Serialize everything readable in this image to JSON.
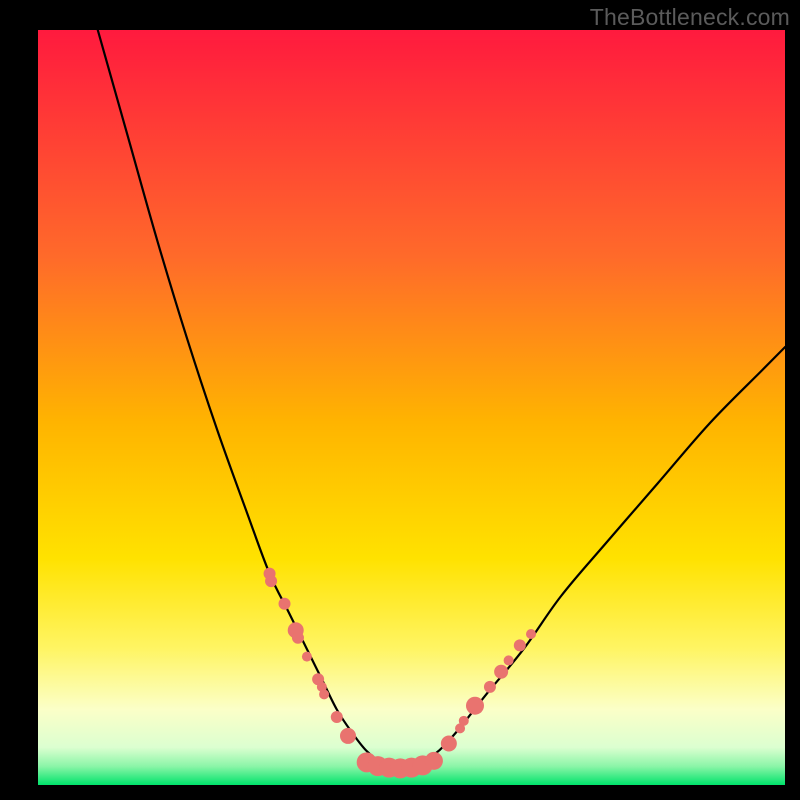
{
  "watermark": "TheBottleneck.com",
  "chart_data": {
    "type": "line",
    "title": "",
    "xlabel": "",
    "ylabel": "",
    "xlim": [
      0,
      100
    ],
    "ylim": [
      0,
      100
    ],
    "grid": false,
    "legend": false,
    "gradient_colors": [
      "#ff1a3e",
      "#ffb400",
      "#ffea00",
      "#fff97a",
      "#f8ffd8",
      "#00e36b"
    ],
    "curve": {
      "name": "bottleneck-curve",
      "x": [
        8,
        12,
        16,
        20,
        24,
        28,
        31,
        33.5,
        36,
        38,
        40,
        42,
        44,
        46,
        48,
        50,
        53,
        56,
        60,
        65,
        70,
        76,
        83,
        90,
        97,
        100
      ],
      "y": [
        100,
        86,
        72,
        59,
        47,
        36,
        28,
        23,
        18,
        14,
        10,
        7,
        4.5,
        3,
        2.3,
        2.5,
        4,
        7,
        12,
        18,
        25,
        32,
        40,
        48,
        55,
        58
      ]
    },
    "markers": {
      "name": "highlight-points",
      "color": "#e9736f",
      "radius_range": [
        4.5,
        11
      ],
      "points": [
        {
          "x": 31.0,
          "y": 28.0,
          "r": 6
        },
        {
          "x": 31.2,
          "y": 27.0,
          "r": 6
        },
        {
          "x": 33.0,
          "y": 24.0,
          "r": 6
        },
        {
          "x": 34.5,
          "y": 20.5,
          "r": 8
        },
        {
          "x": 34.8,
          "y": 19.5,
          "r": 6
        },
        {
          "x": 36.0,
          "y": 17.0,
          "r": 5
        },
        {
          "x": 37.5,
          "y": 14.0,
          "r": 6
        },
        {
          "x": 38.0,
          "y": 13.0,
          "r": 5
        },
        {
          "x": 38.3,
          "y": 12.0,
          "r": 5
        },
        {
          "x": 40.0,
          "y": 9.0,
          "r": 6
        },
        {
          "x": 41.5,
          "y": 6.5,
          "r": 8
        },
        {
          "x": 44.0,
          "y": 3.0,
          "r": 10
        },
        {
          "x": 45.5,
          "y": 2.5,
          "r": 10
        },
        {
          "x": 47.0,
          "y": 2.3,
          "r": 10
        },
        {
          "x": 48.5,
          "y": 2.2,
          "r": 10
        },
        {
          "x": 50.0,
          "y": 2.3,
          "r": 10
        },
        {
          "x": 51.5,
          "y": 2.6,
          "r": 10
        },
        {
          "x": 53.0,
          "y": 3.2,
          "r": 9
        },
        {
          "x": 55.0,
          "y": 5.5,
          "r": 8
        },
        {
          "x": 56.5,
          "y": 7.5,
          "r": 5
        },
        {
          "x": 57.0,
          "y": 8.5,
          "r": 5
        },
        {
          "x": 58.5,
          "y": 10.5,
          "r": 9
        },
        {
          "x": 60.5,
          "y": 13.0,
          "r": 6
        },
        {
          "x": 62.0,
          "y": 15.0,
          "r": 7
        },
        {
          "x": 63.0,
          "y": 16.5,
          "r": 5
        },
        {
          "x": 64.5,
          "y": 18.5,
          "r": 6
        },
        {
          "x": 66.0,
          "y": 20.0,
          "r": 5
        }
      ]
    }
  }
}
